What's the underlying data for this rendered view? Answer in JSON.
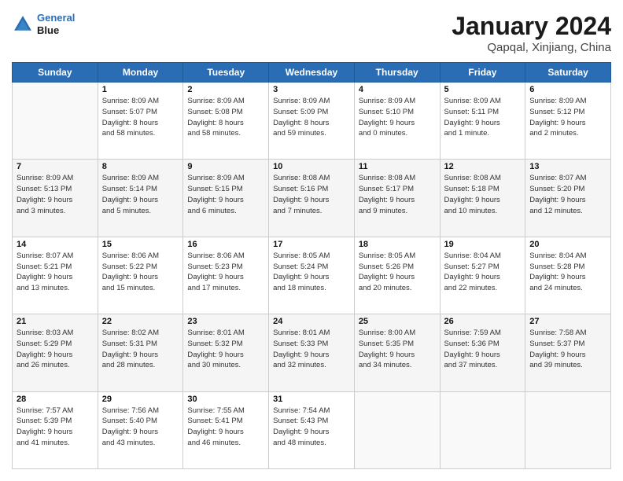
{
  "logo": {
    "line1": "General",
    "line2": "Blue"
  },
  "header": {
    "title": "January 2024",
    "subtitle": "Qapqal, Xinjiang, China"
  },
  "weekdays": [
    "Sunday",
    "Monday",
    "Tuesday",
    "Wednesday",
    "Thursday",
    "Friday",
    "Saturday"
  ],
  "weeks": [
    [
      {
        "day": "",
        "info": ""
      },
      {
        "day": "1",
        "info": "Sunrise: 8:09 AM\nSunset: 5:07 PM\nDaylight: 8 hours\nand 58 minutes."
      },
      {
        "day": "2",
        "info": "Sunrise: 8:09 AM\nSunset: 5:08 PM\nDaylight: 8 hours\nand 58 minutes."
      },
      {
        "day": "3",
        "info": "Sunrise: 8:09 AM\nSunset: 5:09 PM\nDaylight: 8 hours\nand 59 minutes."
      },
      {
        "day": "4",
        "info": "Sunrise: 8:09 AM\nSunset: 5:10 PM\nDaylight: 9 hours\nand 0 minutes."
      },
      {
        "day": "5",
        "info": "Sunrise: 8:09 AM\nSunset: 5:11 PM\nDaylight: 9 hours\nand 1 minute."
      },
      {
        "day": "6",
        "info": "Sunrise: 8:09 AM\nSunset: 5:12 PM\nDaylight: 9 hours\nand 2 minutes."
      }
    ],
    [
      {
        "day": "7",
        "info": "Sunrise: 8:09 AM\nSunset: 5:13 PM\nDaylight: 9 hours\nand 3 minutes."
      },
      {
        "day": "8",
        "info": "Sunrise: 8:09 AM\nSunset: 5:14 PM\nDaylight: 9 hours\nand 5 minutes."
      },
      {
        "day": "9",
        "info": "Sunrise: 8:09 AM\nSunset: 5:15 PM\nDaylight: 9 hours\nand 6 minutes."
      },
      {
        "day": "10",
        "info": "Sunrise: 8:08 AM\nSunset: 5:16 PM\nDaylight: 9 hours\nand 7 minutes."
      },
      {
        "day": "11",
        "info": "Sunrise: 8:08 AM\nSunset: 5:17 PM\nDaylight: 9 hours\nand 9 minutes."
      },
      {
        "day": "12",
        "info": "Sunrise: 8:08 AM\nSunset: 5:18 PM\nDaylight: 9 hours\nand 10 minutes."
      },
      {
        "day": "13",
        "info": "Sunrise: 8:07 AM\nSunset: 5:20 PM\nDaylight: 9 hours\nand 12 minutes."
      }
    ],
    [
      {
        "day": "14",
        "info": "Sunrise: 8:07 AM\nSunset: 5:21 PM\nDaylight: 9 hours\nand 13 minutes."
      },
      {
        "day": "15",
        "info": "Sunrise: 8:06 AM\nSunset: 5:22 PM\nDaylight: 9 hours\nand 15 minutes."
      },
      {
        "day": "16",
        "info": "Sunrise: 8:06 AM\nSunset: 5:23 PM\nDaylight: 9 hours\nand 17 minutes."
      },
      {
        "day": "17",
        "info": "Sunrise: 8:05 AM\nSunset: 5:24 PM\nDaylight: 9 hours\nand 18 minutes."
      },
      {
        "day": "18",
        "info": "Sunrise: 8:05 AM\nSunset: 5:26 PM\nDaylight: 9 hours\nand 20 minutes."
      },
      {
        "day": "19",
        "info": "Sunrise: 8:04 AM\nSunset: 5:27 PM\nDaylight: 9 hours\nand 22 minutes."
      },
      {
        "day": "20",
        "info": "Sunrise: 8:04 AM\nSunset: 5:28 PM\nDaylight: 9 hours\nand 24 minutes."
      }
    ],
    [
      {
        "day": "21",
        "info": "Sunrise: 8:03 AM\nSunset: 5:29 PM\nDaylight: 9 hours\nand 26 minutes."
      },
      {
        "day": "22",
        "info": "Sunrise: 8:02 AM\nSunset: 5:31 PM\nDaylight: 9 hours\nand 28 minutes."
      },
      {
        "day": "23",
        "info": "Sunrise: 8:01 AM\nSunset: 5:32 PM\nDaylight: 9 hours\nand 30 minutes."
      },
      {
        "day": "24",
        "info": "Sunrise: 8:01 AM\nSunset: 5:33 PM\nDaylight: 9 hours\nand 32 minutes."
      },
      {
        "day": "25",
        "info": "Sunrise: 8:00 AM\nSunset: 5:35 PM\nDaylight: 9 hours\nand 34 minutes."
      },
      {
        "day": "26",
        "info": "Sunrise: 7:59 AM\nSunset: 5:36 PM\nDaylight: 9 hours\nand 37 minutes."
      },
      {
        "day": "27",
        "info": "Sunrise: 7:58 AM\nSunset: 5:37 PM\nDaylight: 9 hours\nand 39 minutes."
      }
    ],
    [
      {
        "day": "28",
        "info": "Sunrise: 7:57 AM\nSunset: 5:39 PM\nDaylight: 9 hours\nand 41 minutes."
      },
      {
        "day": "29",
        "info": "Sunrise: 7:56 AM\nSunset: 5:40 PM\nDaylight: 9 hours\nand 43 minutes."
      },
      {
        "day": "30",
        "info": "Sunrise: 7:55 AM\nSunset: 5:41 PM\nDaylight: 9 hours\nand 46 minutes."
      },
      {
        "day": "31",
        "info": "Sunrise: 7:54 AM\nSunset: 5:43 PM\nDaylight: 9 hours\nand 48 minutes."
      },
      {
        "day": "",
        "info": ""
      },
      {
        "day": "",
        "info": ""
      },
      {
        "day": "",
        "info": ""
      }
    ]
  ]
}
